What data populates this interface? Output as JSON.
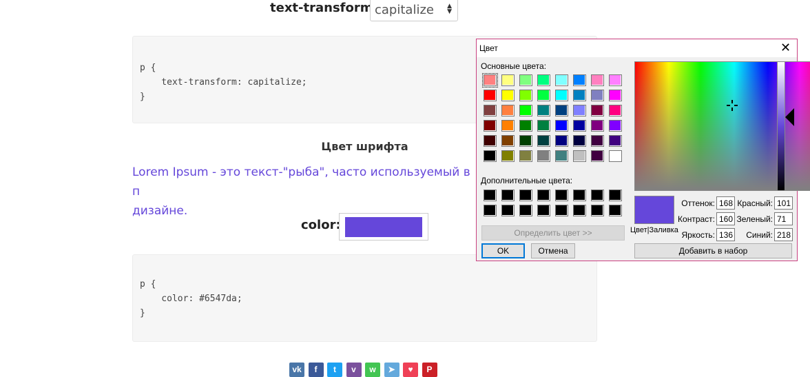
{
  "text_transform": {
    "label": "text-transform:",
    "value": "capitalize"
  },
  "code1": {
    "lines": [
      "p {",
      "    text-transform: capitalize;",
      "}"
    ]
  },
  "font_color_heading": "Цвет шрифта",
  "lorem": {
    "line1": "Lorem Ipsum - это текст-\"рыба\", часто используемый в п",
    "line2": "дизайне."
  },
  "color_field": {
    "label": "color:",
    "value": "#6547da"
  },
  "code2": {
    "lines": [
      "p {",
      "    color: #6547da;",
      "}"
    ]
  },
  "share": [
    {
      "name": "vk",
      "glyph": "vk",
      "color": "#4a76a8"
    },
    {
      "name": "facebook",
      "glyph": "f",
      "color": "#3b5998"
    },
    {
      "name": "twitter",
      "glyph": "t",
      "color": "#1da1f2"
    },
    {
      "name": "viber",
      "glyph": "v",
      "color": "#7b519d"
    },
    {
      "name": "whatsapp",
      "glyph": "w",
      "color": "#43c553"
    },
    {
      "name": "telegram",
      "glyph": "➤",
      "color": "#64a9dc"
    },
    {
      "name": "pocket",
      "glyph": "♥",
      "color": "#ef4056"
    },
    {
      "name": "pinterest",
      "glyph": "P",
      "color": "#cb2027"
    }
  ],
  "dialog": {
    "title": "Цвет",
    "basic_label": "Основные цвета:",
    "basic_colors": [
      [
        "#ff8080",
        "#ffff80",
        "#80ff80",
        "#00ff80",
        "#80ffff",
        "#0080ff",
        "#ff80c0",
        "#ff80ff"
      ],
      [
        "#ff0000",
        "#ffff00",
        "#80ff00",
        "#00ff40",
        "#00ffff",
        "#0080c0",
        "#8080c0",
        "#ff00ff"
      ],
      [
        "#804040",
        "#ff8040",
        "#00ff00",
        "#008080",
        "#004080",
        "#8080ff",
        "#800040",
        "#ff0080"
      ],
      [
        "#800000",
        "#ff8000",
        "#008000",
        "#008040",
        "#0000ff",
        "#0000a0",
        "#800080",
        "#8000ff"
      ],
      [
        "#400000",
        "#804000",
        "#004000",
        "#004040",
        "#000080",
        "#000040",
        "#400040",
        "#400080"
      ],
      [
        "#000000",
        "#808000",
        "#808040",
        "#808080",
        "#408080",
        "#c0c0c0",
        "#400040",
        "#ffffff"
      ]
    ],
    "custom_label": "Дополнительные цвета:",
    "custom_colors": [
      [
        "#000000",
        "#000000",
        "#000000",
        "#000000",
        "#000000",
        "#000000",
        "#000000",
        "#000000"
      ],
      [
        "#000000",
        "#000000",
        "#000000",
        "#000000",
        "#000000",
        "#000000",
        "#000000",
        "#000000"
      ]
    ],
    "define_button": "Определить цвет >>",
    "ok_button": "OK",
    "cancel_button": "Отмена",
    "preview_label": "Цвет|Заливка",
    "hue_label": "Оттенок:",
    "hue": "168",
    "sat_label": "Контраст:",
    "sat": "160",
    "lum_label": "Яркость:",
    "lum": "136",
    "red_label": "Красный:",
    "red": "101",
    "green_label": "Зеленый:",
    "green": "71",
    "blue_label": "Синий:",
    "blue": "218",
    "add_button": "Добавить в набор",
    "current_color": "#6547da"
  }
}
